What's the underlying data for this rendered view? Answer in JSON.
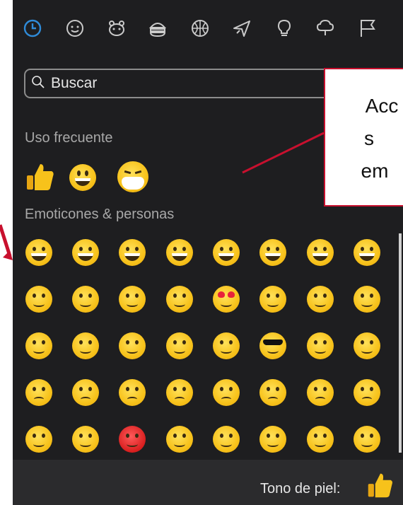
{
  "search": {
    "placeholder": "Buscar"
  },
  "categories": [
    {
      "name": "recent-icon"
    },
    {
      "name": "smiley-icon"
    },
    {
      "name": "animal-icon"
    },
    {
      "name": "food-icon"
    },
    {
      "name": "sports-icon"
    },
    {
      "name": "travel-icon"
    },
    {
      "name": "objects-icon"
    },
    {
      "name": "symbols-icon"
    },
    {
      "name": "flags-icon"
    }
  ],
  "sections": {
    "frequent": "Uso frecuente",
    "emoticons": "Emoticones & personas"
  },
  "callout": {
    "line1": "Acc",
    "line2": "s",
    "line3": "em"
  },
  "footer": {
    "skin_tone_label": "Tono de piel:"
  },
  "colors": {
    "panel": "#1e1e20",
    "accent": "#2f8bd8",
    "callout_border": "#c8102e",
    "emoji": "#f7c21b"
  }
}
